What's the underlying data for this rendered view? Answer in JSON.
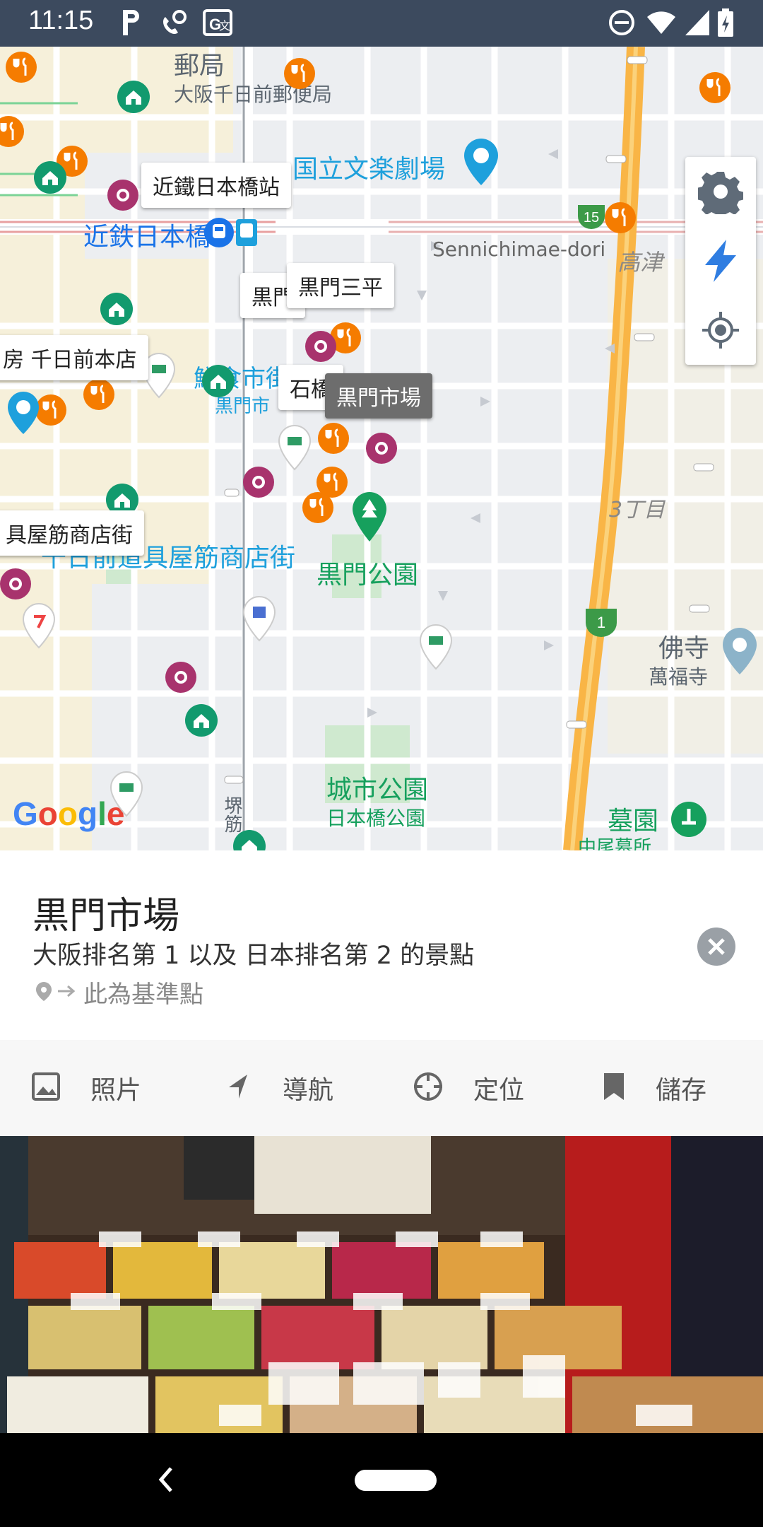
{
  "status_bar": {
    "time": "11:15",
    "left_icons": [
      "parking-icon",
      "phone-icon",
      "translate-icon"
    ],
    "right_icons": [
      "do-not-disturb-icon",
      "wifi-icon",
      "signal-icon",
      "battery-charging-icon"
    ]
  },
  "map": {
    "labels": {
      "post_office": "郵局",
      "post_office_name": "大阪千日前郵便局",
      "bunraku": "国立文楽劇場",
      "kintetsu": "近鉄日本橋",
      "sennichimae_dori": "Sennichimae-dori",
      "takatsu": "高津",
      "food_street": "鮮食市街",
      "kuromon_small": "黒門市",
      "sanchome": "3丁目",
      "dogu_street": "千日前道具屋筋商店街",
      "kuromon_park": "黒門公園",
      "route": "1",
      "route_15": "15",
      "bukkyo": "佛寺",
      "manpukuji": "萬福寺",
      "city_park": "城市公園",
      "nihonbashi_park": "日本橋公園",
      "cemetery": "墓園",
      "cemetery_name": "中尾墓所",
      "sakaisuji": "堺筋",
      "google": "Google"
    },
    "callouts": {
      "kintetsu_station": "近鐵日本橋站",
      "kuromon_partial": "黒門",
      "kuromon_sanpei": "黒門三平",
      "sennichimae_store": "房 千日前本店",
      "ishibashi": "石橋",
      "kuromon_market": "黒門市場",
      "dogu_street_callout": "具屋筋商店街"
    },
    "controls": [
      "gear-icon",
      "bolt-icon",
      "my-location-icon"
    ]
  },
  "place": {
    "title": "黒門市場",
    "description": "大阪排名第 1 以及 日本排名第 2 的景點",
    "reference": "此為基準點",
    "close_icon": "close-icon"
  },
  "actions": [
    {
      "label": "照片",
      "icon": "photo-icon"
    },
    {
      "label": "導航",
      "icon": "navigation-icon"
    },
    {
      "label": "定位",
      "icon": "crosshair-icon"
    },
    {
      "label": "儲存",
      "icon": "bookmark-icon"
    }
  ],
  "photo": {
    "alt": "market-stall-photo"
  },
  "nav_bar": {
    "back_icon": "back-icon",
    "home_icon": "home-pill-icon"
  },
  "colors": {
    "status_bar": "#3c4a5e",
    "map_bg": "#eceef1",
    "main_road": "#f9b546",
    "park_green": "#16a05d",
    "restaurant": "#f57c00",
    "poi_magenta": "#a8336d",
    "water_blue": "#1ea0dc"
  }
}
